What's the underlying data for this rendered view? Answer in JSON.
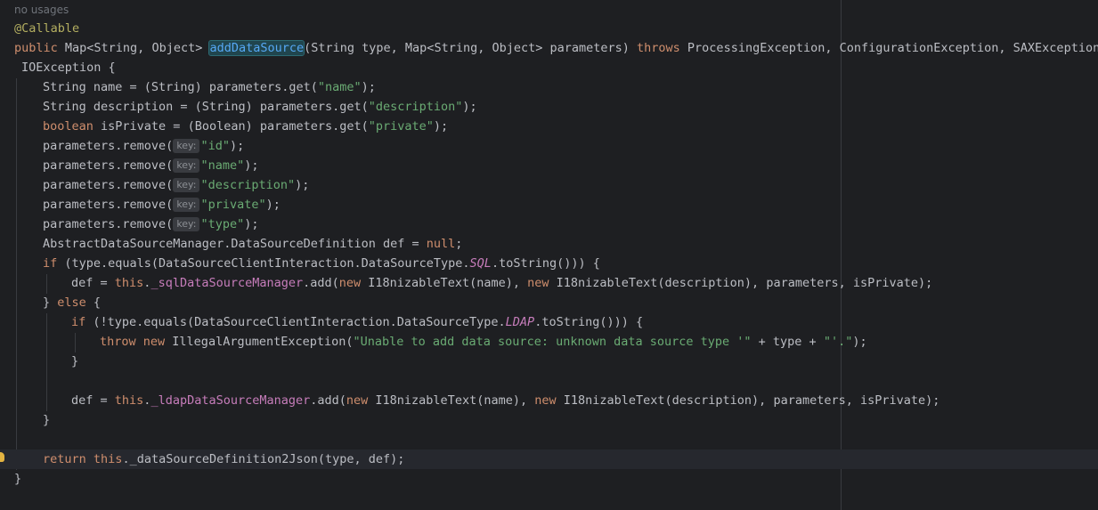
{
  "editor": {
    "usages_hint": "no usages",
    "param_hint_label": "key:",
    "lines": {
      "l1": {
        "ann": "@Callable"
      },
      "l2": {
        "kw_public": "public",
        "t1": " Map<String, Object> ",
        "method": "addDataSource",
        "t2": "(String type, Map<String, Object> parameters) ",
        "kw_throws": "throws",
        "t3": " ProcessingException, ConfigurationException, SAXException,"
      },
      "l3": {
        "t1": "IOException {"
      },
      "l4": {
        "t1": "String name = (String) parameters.get(",
        "s1": "\"name\"",
        "t2": ");"
      },
      "l5": {
        "t1": "String description = (String) parameters.get(",
        "s1": "\"description\"",
        "t2": ");"
      },
      "l6": {
        "kw": "boolean",
        "t1": " isPrivate = (Boolean) parameters.get(",
        "s1": "\"private\"",
        "t2": ");"
      },
      "l7": {
        "t1": "parameters.remove(",
        "s1": "\"id\"",
        "t2": ");"
      },
      "l8": {
        "t1": "parameters.remove(",
        "s1": "\"name\"",
        "t2": ");"
      },
      "l9": {
        "t1": "parameters.remove(",
        "s1": "\"description\"",
        "t2": ");"
      },
      "l10": {
        "t1": "parameters.remove(",
        "s1": "\"private\"",
        "t2": ");"
      },
      "l11": {
        "t1": "parameters.remove(",
        "s1": "\"type\"",
        "t2": ");"
      },
      "l12": {
        "t1": "AbstractDataSourceManager.DataSourceDefinition def = ",
        "kw": "null",
        "t2": ";"
      },
      "l13": {
        "kw": "if",
        "t1": " (type.equals(DataSourceClientInteraction.DataSourceType.",
        "st": "SQL",
        "t2": ".toString())) {"
      },
      "l14": {
        "t1": "def = ",
        "kw_this": "this",
        "t2": ".",
        "fld": "_sqlDataSourceManager",
        "t3": ".add(",
        "kw_new1": "new",
        "t4": " I18nizableText(name), ",
        "kw_new2": "new",
        "t5": " I18nizableText(description), parameters, isPrivate);"
      },
      "l15": {
        "t1": "} ",
        "kw": "else",
        "t2": " {"
      },
      "l16": {
        "kw": "if",
        "t1": " (!type.equals(DataSourceClientInteraction.DataSourceType.",
        "st": "LDAP",
        "t2": ".toString())) {"
      },
      "l17": {
        "kw_throw": "throw",
        "t1": " ",
        "kw_new": "new",
        "t2": " IllegalArgumentException(",
        "s1": "\"Unable to add data source: unknown data source type '\"",
        "t3": " + type + ",
        "s2": "\"'.\"",
        "t4": ");"
      },
      "l18": {
        "t1": "}"
      },
      "l20": {
        "t1": "def = ",
        "kw_this": "this",
        "t2": ".",
        "fld": "_ldapDataSourceManager",
        "t3": ".add(",
        "kw_new1": "new",
        "t4": " I18nizableText(name), ",
        "kw_new2": "new",
        "t5": " I18nizableText(description), parameters, isPrivate);"
      },
      "l21": {
        "t1": "}"
      },
      "l23": {
        "kw_return": "return",
        "t1": " ",
        "kw_this": "this",
        "t2": "._dataSourceDefinition2Json(type, def);"
      },
      "l24": {
        "t1": "}"
      }
    }
  },
  "colors": {
    "background": "#1e1f22",
    "keyword": "#cf8e6d",
    "string": "#6aab73",
    "annotation": "#b3ae60",
    "field": "#c77dbb",
    "method_declaration": "#56a8f5",
    "plain_text": "#bcbec4"
  },
  "icons": {
    "gutter_icon": "intention-bulb-icon"
  }
}
